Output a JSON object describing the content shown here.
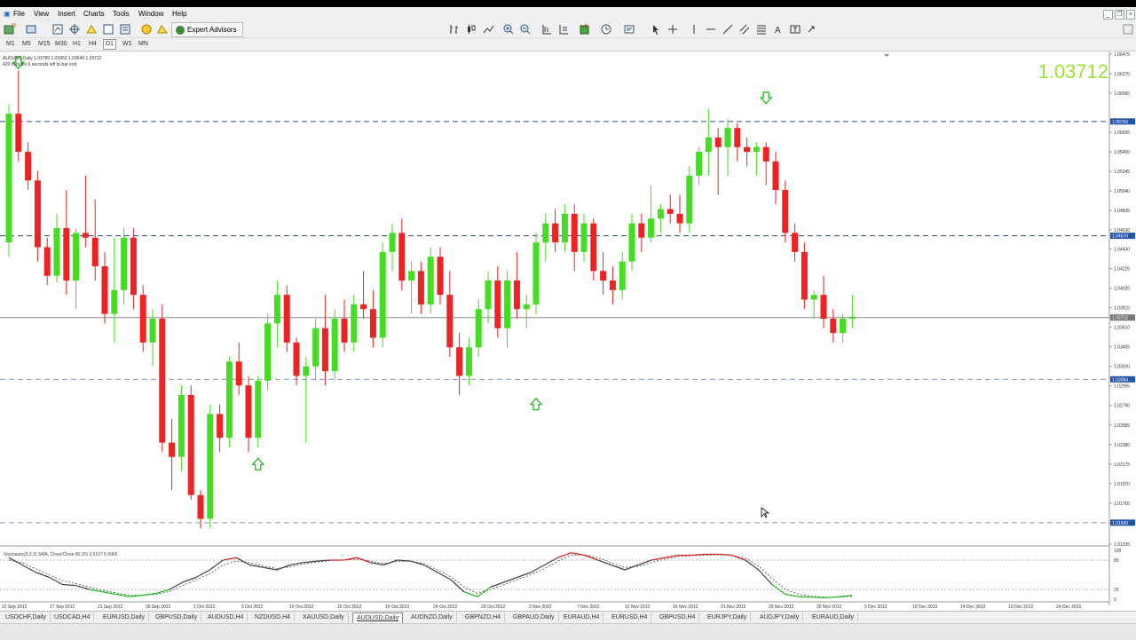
{
  "menu": [
    "File",
    "View",
    "Insert",
    "Charts",
    "Tools",
    "Window",
    "Help"
  ],
  "toolbar": {
    "expert_advisors_label": "Expert Advisors"
  },
  "timeframes": [
    "M1",
    "M5",
    "M15",
    "M30",
    "H1",
    "H4",
    "D1",
    "W1",
    "MN"
  ],
  "active_timeframe": "D1",
  "chart": {
    "symbol_line": "AUDUSD,Daily  1.03789 1.03953 1.03648 1.03712",
    "timer_line": "420 minutes 6 seconds left to bar end",
    "current_price": "1.03712",
    "indicator_label": "Stochastic(5,3,3) SMA, Close/Close 80,20) 3.6107 5.9965",
    "up_color": "#44dd22",
    "down_color": "#ee2222",
    "arrow_color": "#22bb22"
  },
  "chart_data": {
    "type": "candlestick",
    "y_range": [
      1.01335,
      1.06475
    ],
    "y_ticks": [
      "1.06475",
      "1.06270",
      "1.06065",
      "1.05655",
      "1.05450",
      "1.05245",
      "1.05040",
      "1.04835",
      "1.04630",
      "1.04430",
      "1.04225",
      "1.04020",
      "1.03815",
      "1.03610",
      "1.03405",
      "1.03200",
      "1.02995",
      "1.02790",
      "1.02585",
      "1.02380",
      "1.02175",
      "1.01970",
      "1.01765",
      "1.01560",
      "1.01335"
    ],
    "hlines": [
      {
        "value": 1.05769,
        "label": "1.05769",
        "style": "dashed"
      },
      {
        "value": 1.0457,
        "label": "1.04570",
        "style": "dashed"
      },
      {
        "value": 1.03712,
        "label": "1.03712",
        "style": "solid"
      },
      {
        "value": 1.03064,
        "label": "1.03064",
        "style": "dashed-light"
      },
      {
        "value": 1.0156,
        "label": "1.01560",
        "style": "dashed-light"
      }
    ],
    "x_labels": [
      "12 Sep 2012",
      "17 Sep 2012",
      "21 Sep 2012",
      "26 Sep 2012",
      "1 Oct 2012",
      "5 Oct 2012",
      "10 Oct 2012",
      "15 Oct 2012",
      "19 Oct 2012",
      "24 Oct 2012",
      "29 Oct 2012",
      "2 Nov 2012",
      "7 Nov 2012",
      "12 Nov 2012",
      "16 Nov 2012",
      "21 Nov 2012",
      "26 Nov 2012",
      "30 Nov 2012",
      "5 Dec 2012",
      "10 Dec 2012",
      "14 Dec 2012",
      "19 Dec 2012",
      "24 Dec 2012"
    ],
    "ohlc": [
      [
        1.045,
        1.0595,
        1.0435,
        1.0585
      ],
      [
        1.0585,
        1.063,
        1.0535,
        1.0545
      ],
      [
        1.0545,
        1.0555,
        1.0505,
        1.0515
      ],
      [
        1.0515,
        1.0525,
        1.043,
        1.0445
      ],
      [
        1.0445,
        1.0455,
        1.0405,
        1.0415
      ],
      [
        1.0415,
        1.048,
        1.0408,
        1.0465
      ],
      [
        1.0465,
        1.0505,
        1.0395,
        1.041
      ],
      [
        1.041,
        1.0465,
        1.038,
        1.046
      ],
      [
        1.046,
        1.052,
        1.0445,
        1.0455
      ],
      [
        1.0455,
        1.0495,
        1.041,
        1.0425
      ],
      [
        1.0425,
        1.044,
        1.0365,
        1.0375
      ],
      [
        1.0375,
        1.0455,
        1.0345,
        1.04
      ],
      [
        1.04,
        1.0465,
        1.0385,
        1.0455
      ],
      [
        1.0455,
        1.0465,
        1.038,
        1.0395
      ],
      [
        1.0395,
        1.0405,
        1.0335,
        1.0345
      ],
      [
        1.0345,
        1.038,
        1.032,
        1.037
      ],
      [
        1.037,
        1.0385,
        1.023,
        1.024
      ],
      [
        1.024,
        1.0265,
        1.019,
        1.0225
      ],
      [
        1.0225,
        1.03,
        1.021,
        1.029
      ],
      [
        1.029,
        1.03,
        1.018,
        1.0185
      ],
      [
        1.0185,
        1.019,
        1.015,
        1.016
      ],
      [
        1.016,
        1.028,
        1.015,
        1.027
      ],
      [
        1.027,
        1.028,
        1.023,
        1.0245
      ],
      [
        1.0245,
        1.033,
        1.0235,
        1.0325
      ],
      [
        1.0325,
        1.0345,
        1.029,
        1.03
      ],
      [
        1.03,
        1.031,
        1.023,
        1.0245
      ],
      [
        1.0245,
        1.031,
        1.0235,
        1.0305
      ],
      [
        1.0305,
        1.0375,
        1.0295,
        1.0365
      ],
      [
        1.0365,
        1.041,
        1.034,
        1.0395
      ],
      [
        1.0395,
        1.0405,
        1.0335,
        1.0345
      ],
      [
        1.0345,
        1.035,
        1.03,
        1.031
      ],
      [
        1.031,
        1.033,
        1.024,
        1.032
      ],
      [
        1.032,
        1.037,
        1.0305,
        1.036
      ],
      [
        1.036,
        1.0395,
        1.03,
        1.0315
      ],
      [
        1.0315,
        1.038,
        1.0305,
        1.037
      ],
      [
        1.037,
        1.039,
        1.0335,
        1.0345
      ],
      [
        1.0345,
        1.0395,
        1.0335,
        1.0385
      ],
      [
        1.0385,
        1.042,
        1.037,
        1.038
      ],
      [
        1.038,
        1.04,
        1.034,
        1.035
      ],
      [
        1.035,
        1.045,
        1.034,
        1.044
      ],
      [
        1.044,
        1.047,
        1.042,
        1.046
      ],
      [
        1.046,
        1.0475,
        1.04,
        1.041
      ],
      [
        1.041,
        1.043,
        1.0375,
        1.042
      ],
      [
        1.042,
        1.043,
        1.0375,
        1.0385
      ],
      [
        1.0385,
        1.0445,
        1.0375,
        1.0435
      ],
      [
        1.0435,
        1.0445,
        1.0385,
        1.0395
      ],
      [
        1.0395,
        1.042,
        1.033,
        1.034
      ],
      [
        1.034,
        1.0355,
        1.029,
        1.031
      ],
      [
        1.031,
        1.035,
        1.03,
        1.034
      ],
      [
        1.034,
        1.039,
        1.033,
        1.038
      ],
      [
        1.038,
        1.042,
        1.0365,
        1.041
      ],
      [
        1.041,
        1.0425,
        1.035,
        1.036
      ],
      [
        1.036,
        1.042,
        1.034,
        1.041
      ],
      [
        1.041,
        1.044,
        1.037,
        1.038
      ],
      [
        1.038,
        1.0395,
        1.036,
        1.0385
      ],
      [
        1.0385,
        1.046,
        1.0375,
        1.045
      ],
      [
        1.045,
        1.048,
        1.043,
        1.047
      ],
      [
        1.047,
        1.0485,
        1.044,
        1.045
      ],
      [
        1.045,
        1.049,
        1.044,
        1.048
      ],
      [
        1.048,
        1.049,
        1.042,
        1.044
      ],
      [
        1.044,
        1.048,
        1.043,
        1.047
      ],
      [
        1.047,
        1.0475,
        1.041,
        1.042
      ],
      [
        1.042,
        1.044,
        1.0395,
        1.041
      ],
      [
        1.041,
        1.0425,
        1.0385,
        1.04
      ],
      [
        1.04,
        1.044,
        1.039,
        1.043
      ],
      [
        1.043,
        1.048,
        1.042,
        1.047
      ],
      [
        1.047,
        1.048,
        1.044,
        1.0455
      ],
      [
        1.0455,
        1.051,
        1.045,
        1.0475
      ],
      [
        1.0475,
        1.049,
        1.046,
        1.0485
      ],
      [
        1.0485,
        1.05,
        1.047,
        1.048
      ],
      [
        1.048,
        1.05,
        1.046,
        1.047
      ],
      [
        1.047,
        1.053,
        1.046,
        1.052
      ],
      [
        1.052,
        1.055,
        1.051,
        1.0545
      ],
      [
        1.0545,
        1.059,
        1.052,
        1.056
      ],
      [
        1.056,
        1.057,
        1.05,
        1.055
      ],
      [
        1.055,
        1.058,
        1.052,
        1.057
      ],
      [
        1.057,
        1.0575,
        1.0535,
        1.055
      ],
      [
        1.055,
        1.056,
        1.053,
        1.0545
      ],
      [
        1.0545,
        1.0555,
        1.052,
        1.055
      ],
      [
        1.055,
        1.0555,
        1.051,
        1.0535
      ],
      [
        1.0535,
        1.0545,
        1.049,
        1.0505
      ],
      [
        1.0505,
        1.0515,
        1.045,
        1.046
      ],
      [
        1.046,
        1.047,
        1.043,
        1.044
      ],
      [
        1.044,
        1.045,
        1.038,
        1.039
      ],
      [
        1.039,
        1.04,
        1.037,
        1.0395
      ],
      [
        1.0395,
        1.0415,
        1.036,
        1.037
      ],
      [
        1.037,
        1.038,
        1.0345,
        1.0355
      ],
      [
        1.0355,
        1.0375,
        1.0345,
        1.037
      ],
      [
        1.037,
        1.0395,
        1.036,
        1.0372
      ]
    ],
    "oscillator": {
      "levels": [
        "100",
        "80",
        "20",
        "0"
      ],
      "main": [
        85,
        70,
        55,
        45,
        30,
        28,
        20,
        15,
        10,
        5,
        8,
        12,
        20,
        35,
        45,
        60,
        80,
        85,
        70,
        65,
        60,
        70,
        75,
        78,
        80,
        80,
        85,
        75,
        70,
        80,
        78,
        70,
        55,
        40,
        15,
        5,
        25,
        35,
        45,
        55,
        70,
        85,
        95,
        90,
        80,
        70,
        60,
        70,
        80,
        85,
        90,
        90,
        92,
        92,
        90,
        80,
        60,
        30,
        10,
        5,
        4,
        3,
        5,
        8
      ],
      "signal": [
        80,
        75,
        62,
        50,
        38,
        32,
        25,
        18,
        13,
        8,
        8,
        10,
        16,
        28,
        40,
        52,
        70,
        78,
        75,
        68,
        63,
        66,
        72,
        76,
        79,
        80,
        82,
        78,
        73,
        77,
        78,
        73,
        60,
        46,
        25,
        12,
        20,
        30,
        40,
        50,
        62,
        78,
        90,
        91,
        85,
        75,
        65,
        67,
        75,
        82,
        87,
        89,
        90,
        91,
        90,
        84,
        68,
        42,
        20,
        10,
        6,
        4,
        4,
        6
      ]
    },
    "arrows": [
      {
        "bar": 1,
        "dir": "down",
        "price": 1.0638
      },
      {
        "bar": 26,
        "dir": "up",
        "price": 1.0218
      },
      {
        "bar": 55,
        "dir": "up",
        "price": 1.0281
      },
      {
        "bar": 79,
        "dir": "down",
        "price": 1.0601
      }
    ]
  },
  "tabs": [
    "USDCHF,Daily",
    "USDCAD,H4",
    "EURUSD,Daily",
    "GBPUSD,Daily",
    "AUDUSD,H4",
    "NZDUSD,H4",
    "XAUUSD,Daily",
    "AUDUSD,Daily",
    "AUDNZD,Daily",
    "GBPNZD,H4",
    "GBPAUD,Daily",
    "EURAUD,H4",
    "EURUSD,H4",
    "GBPUSD,H4",
    "EURJPY,Daily",
    "AUDJPY,Daily",
    "EURAUD,Daily"
  ],
  "active_tab": "AUDUSD,Daily"
}
